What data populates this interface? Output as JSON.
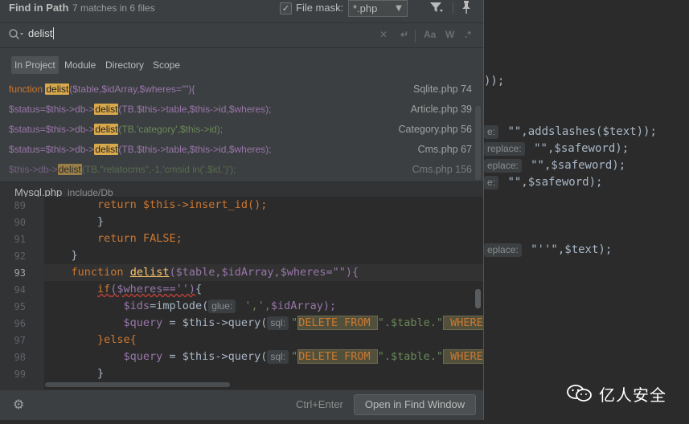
{
  "find": {
    "title": "Find in Path",
    "subtitle": "7 matches in 6 files",
    "file_mask_label": "File mask:",
    "file_mask_value": "*.php",
    "search_text": "delist",
    "regex_label": ".*",
    "case_label": "Aa",
    "word_label": "W"
  },
  "scopes": [
    {
      "label": "In Project"
    },
    {
      "label": "Module"
    },
    {
      "label": "Directory"
    },
    {
      "label": "Scope"
    }
  ],
  "results": [
    {
      "pre": "function ",
      "match": "delist",
      "post": "($table,$idArray,$wheres=\"\"){",
      "file": "Sqlite.php 74"
    },
    {
      "pre": "$status=$this->db->",
      "match": "delist",
      "post": "(TB.$this->table,$this->id,$wheres);",
      "file": "Article.php 39"
    },
    {
      "pre": "$status=$this->db->",
      "match": "delist",
      "post": "(TB.'category',$this->id);",
      "file": "Category.php 56"
    },
    {
      "pre": "$status=$this->db->",
      "match": "delist",
      "post": "(TB.$this->table,$this->id,$wheres);",
      "file": "Cms.php 67"
    },
    {
      "pre": "$this->db->",
      "match": "delist",
      "post": "(TB.\"relatocms\",-1,'cmsid in('.$id.')');",
      "file": "Cms.php 156"
    }
  ],
  "preview_file": {
    "name": "Mysql.php",
    "path": "include/Db"
  },
  "line_numbers": [
    "89",
    "90",
    "91",
    "92",
    "93",
    "94",
    "95",
    "96",
    "97",
    "98",
    "99"
  ],
  "code": {
    "l89": "return $this->insert_id();",
    "l90": "}",
    "l91_kw": "return",
    "l91_rest": " FALSE;",
    "l92": "}",
    "l93_kw": "function",
    "l93_fn": "delist",
    "l93_args": "($table,$idArray,$wheres=\"\"){",
    "l94_kw": "if",
    "l94_rest": "($wheres=='')",
    "l94_end": "{",
    "l95_var": "$ids",
    "l95_mid": "=implode(",
    "l95_hint": "glue:",
    "l95_str": " ',',",
    "l95_end": "$idArray);",
    "l96_var": "$query",
    "l96_mid": " = $this->query(",
    "l96_hint": "sql:",
    "l96_open": "\"",
    "l96_sql": "DELETE FROM ",
    "l96_close": "\".$table.\"",
    "l96_where": " WHERE",
    "l97": "}else{",
    "l98_var": "$query",
    "l98_mid": " = $this->query(",
    "l98_hint": "sql:",
    "l98_open": "\"",
    "l98_sql": "DELETE FROM ",
    "l98_close": "\".$table.\"",
    "l98_where": " WHERE",
    "l99": "}"
  },
  "bg": {
    "line1": "));",
    "line2_hint": "e:",
    "line2_rest": " \"\",addslashes($text));",
    "line3_hint": "replace:",
    "line3_rest": " \"\",$safeword);",
    "line4_hint": "eplace:",
    "line4_rest": " \"\",$safeword);",
    "line5_hint": "e:",
    "line5_rest": " \"\",$safeword);",
    "line6_hint": "eplace:",
    "line6_rest": " \"''\",$text);"
  },
  "footer": {
    "shortcut": "Ctrl+Enter",
    "open_button": "Open in Find Window"
  },
  "watermark": {
    "text": "亿人安全"
  },
  "colors": {
    "match_highlight": "#d8a84c",
    "keyword": "#cc7832",
    "variable": "#9876aa",
    "string": "#6a8759",
    "function": "#ffc66d"
  }
}
